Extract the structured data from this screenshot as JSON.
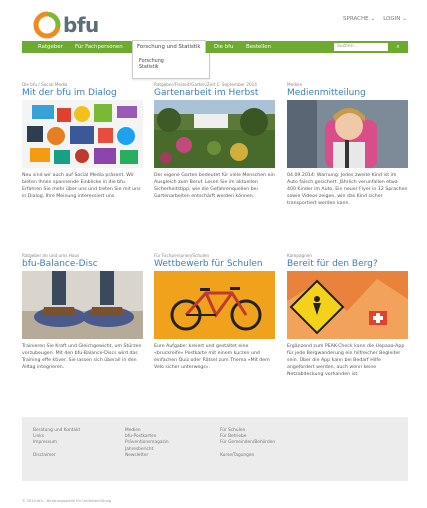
{
  "header": {
    "brand": "bfu",
    "top_links": [
      {
        "label": "SPRACHE"
      },
      {
        "label": "LOGIN"
      }
    ]
  },
  "nav": {
    "items": [
      {
        "label": "Ratgeber"
      },
      {
        "label": "Für Fachpersonen"
      },
      {
        "label": "Forschung und Statistik"
      },
      {
        "label": "Die bfu"
      },
      {
        "label": "Bestellen"
      }
    ],
    "search_placeholder": "Suchen...",
    "dropdown": [
      "Forschung",
      "Statistik"
    ]
  },
  "cards": [
    {
      "category": "Die bfu / Social Media",
      "title": "Mit der bfu im Dialog",
      "text": "Neu sind wir auch auf Social Media präsent. Wir bieten Ihnen spannende Einblicke in die bfu. Erfahren Sie mehr über uns und treten Sie mit uns in Dialog. Ihre Meinung interessiert uns."
    },
    {
      "category": "Ratgeber/Freizeit/Garten/Zeit 1. September 2014",
      "title": "Gartenarbeit im Herbst",
      "text": "Der eigene Garten bedeutet für viele Menschen ein Ausgleich zum Beruf. Lesen Sie im aktuellen Sicherheitstipp, wie die Gefahrenquellen bei Gartenarbeiten entschärft werden können."
    },
    {
      "category": "Medien",
      "title": "Medienmitteilung",
      "text": "04.09.2014: Warnung: Jedes zweite Kind ist im Auto falsch gesichert. Jährlich verunfallen etwa 400 Kinder im Auto. Ein neuer Flyer in 12 Sprachen sowie Videos zeigen, wie das Kind sicher transportiert werden kann."
    },
    {
      "category": "Ratgeber Im und ums Haus",
      "title": "bfu-Balance-Disc",
      "text": "Trainieren Sie Kraft und Gleichgewicht, um Stürzen vorzubeugen. Mit den bfu-Balance-Discs wird das Training effe ktiver. Sie lassen sich überall in den Alltag integrieren."
    },
    {
      "category": "Für Fachpersonen/Schulen",
      "title": "Wettbewerb für Schulen",
      "text": "Eure Aufgabe: kreiert und gestaltet eine «bruckreife» Postkarte mit einem kurzen und einfachen Quiz oder Rätsel zum Thema «Mit dem Velo sicher unterwegs»."
    },
    {
      "category": "Kampagnen",
      "title": "Bereit für den Berg?",
      "text": "Ergänzend zum PEAK-Check kann die Uepaaa-App für jede Bergwanderung ein hilfreicher Begleiter sein. Über die App kann bei Bedarf Hilfe angefordert werden, auch wenn keine Netzabdeckung vorhanden ist."
    }
  ],
  "footer": {
    "col1": [
      "Beratung und Kontakt",
      "Links",
      "Impressum",
      "",
      "Disclaimer"
    ],
    "col2": [
      "Medien",
      "bfu-Postkarten",
      "Präventionsmagazin",
      "Jahresbericht",
      "Newsletter"
    ],
    "col3": [
      "Für Schulen",
      "Für Betriebe",
      "Für Gemeinden/Behörden",
      "",
      "Kurse/Tagungen"
    ],
    "copyright": "© 2014 bfu – Beratungsstelle für Unfallverhütung"
  },
  "colors": {
    "nav_green": "#6cab2f",
    "link_blue": "#3b7fc4",
    "logo_orange": "#f08a1c",
    "logo_green": "#7ab933"
  }
}
